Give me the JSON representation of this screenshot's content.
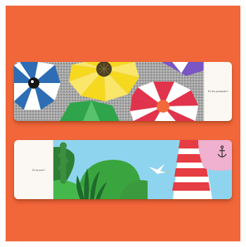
{
  "books": [
    {
      "id": "top",
      "caption": "Et les parasols?"
    },
    {
      "id": "bottom",
      "caption": "Et la mer?"
    }
  ],
  "colors": {
    "background": "#f2673a",
    "page": "#fbf8f3",
    "sand": "#9e9e9e",
    "umbrella_yellow": "#f6d81f",
    "umbrella_blue": "#2d6db5",
    "umbrella_red": "#e2334d",
    "umbrella_green": "#2fa44a",
    "umbrella_purple": "#7a55c4",
    "sky": "#8fd4ee",
    "tree_green": "#3a9a3d",
    "lighthouse_red": "#e63c43",
    "sail_pink": "#f0b0cf"
  }
}
